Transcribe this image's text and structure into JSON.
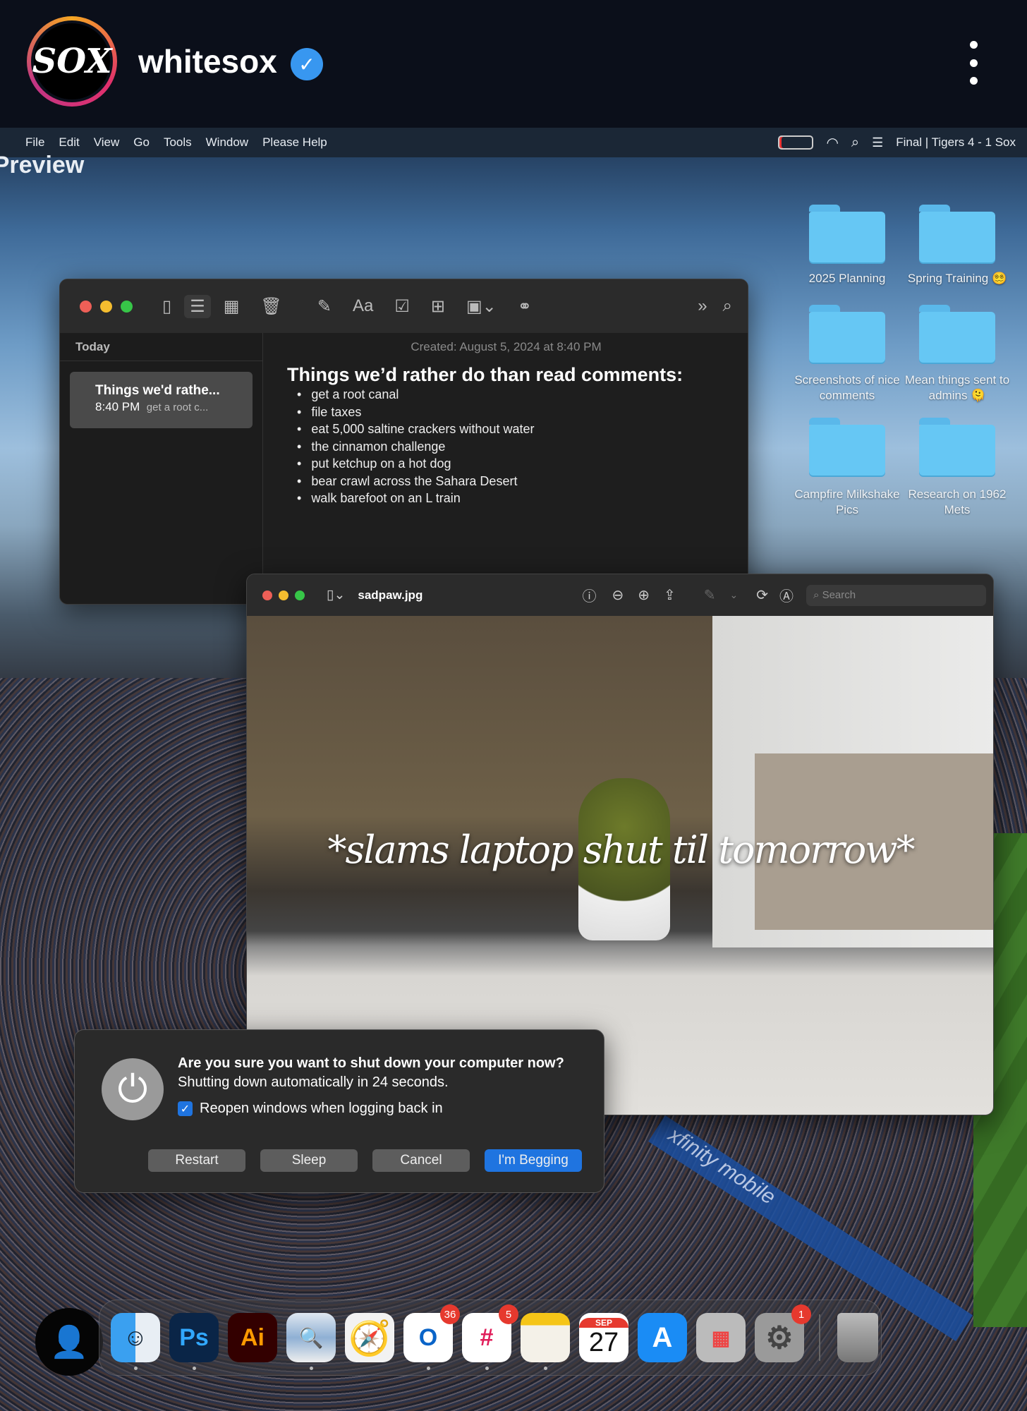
{
  "header": {
    "username": "whitesox",
    "logo_text": "SOX",
    "verified": true
  },
  "menubar": {
    "app": "Preview",
    "items": [
      "File",
      "Edit",
      "View",
      "Go",
      "Tools",
      "Window",
      "Please Help"
    ],
    "status": "Final | Tigers 4 - 1 Sox"
  },
  "folders": [
    {
      "label": "2025 Planning"
    },
    {
      "label": "Spring Training 😵‍💫"
    },
    {
      "label": "Screenshots of nice comments"
    },
    {
      "label": "Mean things sent to admins 🫠"
    },
    {
      "label": "Campfire Milkshake Pics"
    },
    {
      "label": "Research on 1962 Mets"
    }
  ],
  "notes": {
    "section": "Today",
    "note_title": "Things we'd rathe...",
    "note_time": "8:40 PM",
    "note_preview": "get a root c...",
    "created": "Created: August 5, 2024 at 8:40 PM",
    "heading": "Things we’d rather do than read comments:",
    "items": [
      "get a root canal",
      "file taxes",
      "eat 5,000 saltine crackers without water",
      "the cinnamon challenge",
      "put ketchup on a hot dog",
      "bear crawl across the Sahara Desert",
      "walk barefoot on an L train"
    ]
  },
  "preview": {
    "filename": "sadpaw.jpg",
    "search_placeholder": "Search",
    "caption": "*slams laptop shut til tomorrow*"
  },
  "dialog": {
    "question": "Are you sure you want to shut down your computer now?",
    "detail": "Shutting down automatically in 24 seconds.",
    "checkbox_label": "Reopen windows when logging back in",
    "checkbox_checked": true,
    "buttons": [
      "Restart",
      "Sleep",
      "Cancel",
      "I'm Begging"
    ],
    "accent": "#1f74e0"
  },
  "dock": {
    "apps": [
      {
        "name": "Finder"
      },
      {
        "name": "Photoshop",
        "label": "Ps"
      },
      {
        "name": "Illustrator",
        "label": "Ai"
      },
      {
        "name": "Preview"
      },
      {
        "name": "Safari"
      },
      {
        "name": "Outlook",
        "badge": "36"
      },
      {
        "name": "Slack",
        "badge": "5"
      },
      {
        "name": "Notes"
      },
      {
        "name": "Calendar",
        "month": "SEP",
        "day": "27"
      },
      {
        "name": "App Store"
      },
      {
        "name": "Launchpad"
      },
      {
        "name": "System Settings",
        "badge": "1"
      },
      {
        "name": "Trash"
      }
    ]
  }
}
